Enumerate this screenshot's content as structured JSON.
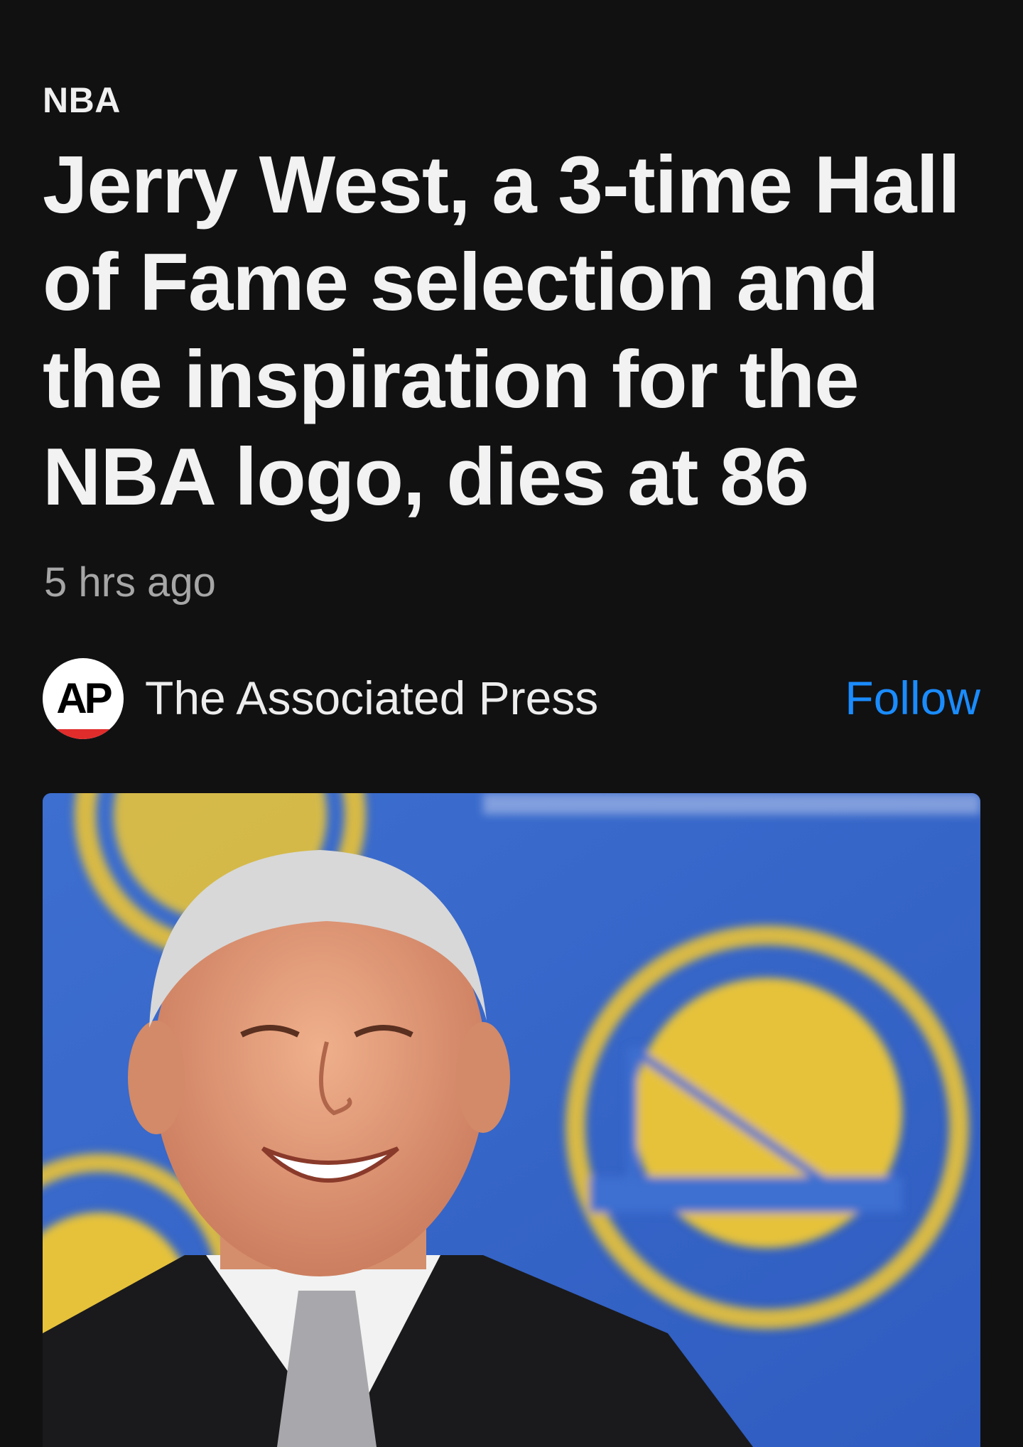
{
  "article": {
    "category": "NBA",
    "headline": "Jerry West, a 3-time Hall of Fame selection and the inspiration for the NBA logo, dies at 86",
    "timestamp": "5 hrs ago"
  },
  "publisher": {
    "logo_text": "AP",
    "name": "The Associated Press",
    "follow_label": "Follow"
  },
  "colors": {
    "background": "#111112",
    "accent": "#1a8cff",
    "backdrop_blue": "#3a66c8",
    "backdrop_gold": "#e6c23a"
  }
}
